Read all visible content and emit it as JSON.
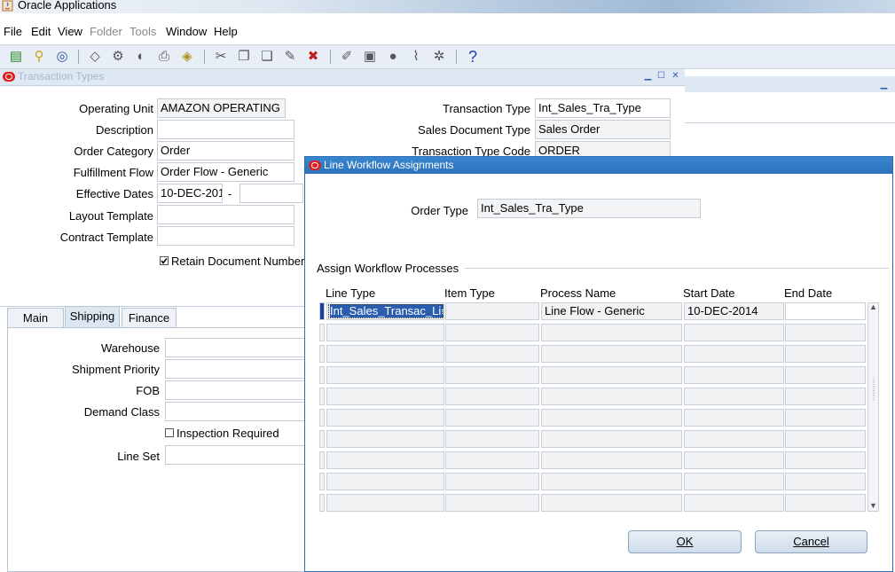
{
  "app": {
    "title": "Oracle Applications"
  },
  "menu": [
    {
      "label": "File"
    },
    {
      "label": "Edit"
    },
    {
      "label": "View"
    },
    {
      "label": "Folder"
    },
    {
      "label": "Tools"
    },
    {
      "label": "Window"
    },
    {
      "label": "Help"
    }
  ],
  "toolbar": {
    "help_glyph": "?"
  },
  "transaction_types": {
    "title": "Transaction Types",
    "operating_unit": {
      "label": "Operating Unit",
      "value": "AMAZON OPERATING"
    },
    "description": {
      "label": "Description",
      "value": ""
    },
    "order_category": {
      "label": "Order Category",
      "value": "Order"
    },
    "fulfillment_flow": {
      "label": "Fulfillment Flow",
      "value": "Order Flow - Generic"
    },
    "effective_dates": {
      "label": "Effective Dates",
      "from": "10-DEC-201",
      "separator": "-",
      "to": ""
    },
    "layout_template": {
      "label": "Layout Template",
      "value": ""
    },
    "contract_template": {
      "label": "Contract Template",
      "value": ""
    },
    "retain_document_number": {
      "label": "Retain Document Number",
      "checked": true
    },
    "transaction_type": {
      "label": "Transaction Type",
      "value": "Int_Sales_Tra_Type"
    },
    "sales_document_type": {
      "label": "Sales Document Type",
      "value": "Sales Order"
    },
    "transaction_type_code": {
      "label": "Transaction Type Code",
      "value": "ORDER"
    },
    "tabs": [
      {
        "label": "Main"
      },
      {
        "label": "Shipping"
      },
      {
        "label": "Finance"
      }
    ],
    "active_tab": "Shipping",
    "shipping": {
      "warehouse": {
        "label": "Warehouse",
        "value": ""
      },
      "shipment_priority": {
        "label": "Shipment Priority",
        "value": ""
      },
      "fob": {
        "label": "FOB",
        "value": ""
      },
      "demand_class": {
        "label": "Demand Class",
        "value": ""
      },
      "inspection_required": {
        "label": "Inspection Required",
        "checked": false
      },
      "line_set": {
        "label": "Line Set",
        "value": ""
      }
    }
  },
  "dialog": {
    "title": "Line Workflow Assignments",
    "order_type": {
      "label": "Order Type",
      "value": "Int_Sales_Tra_Type"
    },
    "section_label": "Assign Workflow Processes",
    "columns": [
      "Line Type",
      "Item Type",
      "Process Name",
      "Start Date",
      "End Date"
    ],
    "rows": [
      [
        "Int_Sales_Transac_Lin",
        "",
        "Line Flow - Generic",
        "10-DEC-2014",
        ""
      ],
      [
        "",
        "",
        "",
        "",
        ""
      ],
      [
        "",
        "",
        "",
        "",
        ""
      ],
      [
        "",
        "",
        "",
        "",
        ""
      ],
      [
        "",
        "",
        "",
        "",
        ""
      ],
      [
        "",
        "",
        "",
        "",
        ""
      ],
      [
        "",
        "",
        "",
        "",
        ""
      ],
      [
        "",
        "",
        "",
        "",
        ""
      ],
      [
        "",
        "",
        "",
        "",
        ""
      ],
      [
        "",
        "",
        "",
        "",
        ""
      ]
    ],
    "ok_label": "OK",
    "cancel_label": "Cancel"
  },
  "colors": {
    "oracle_red": "#e02020",
    "dialog_title": "#2b73bd",
    "selection": "#2a5db0"
  }
}
